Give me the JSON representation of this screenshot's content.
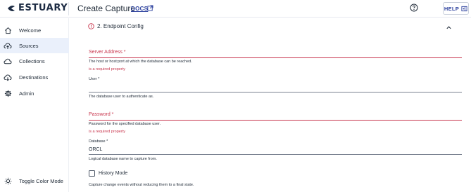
{
  "header": {
    "logo_text": "ESTUARY",
    "page_title": "Create Capture",
    "docs_label": "DOCS",
    "help_label": "HELP"
  },
  "sidebar": {
    "items": [
      {
        "label": "Welcome",
        "icon": "home-icon",
        "active": false
      },
      {
        "label": "Sources",
        "icon": "cloud-upload-icon",
        "active": true
      },
      {
        "label": "Collections",
        "icon": "cloud-icon",
        "active": false
      },
      {
        "label": "Destinations",
        "icon": "cloud-download-icon",
        "active": false
      },
      {
        "label": "Admin",
        "icon": "gear-icon",
        "active": false
      }
    ],
    "toggle_color_mode": "Toggle Color Mode"
  },
  "section": {
    "title": "2. Endpoint Config"
  },
  "fields": {
    "server_address": {
      "label": "Server Address *",
      "helper": "The host or host:port at which the database can be reached.",
      "error": "is a required property"
    },
    "user": {
      "label": "User *",
      "helper": "The database user to authenticate as."
    },
    "password": {
      "label": "Password *",
      "helper": "Password for the specified database user.",
      "error": "is a required property"
    },
    "database": {
      "label": "Database *",
      "value": "ORCL",
      "helper": "Logical database name to capture from."
    },
    "history_mode": {
      "label": "History Mode",
      "helper": "Capture change events without reducing them to a final state.",
      "checked": false
    }
  },
  "colors": {
    "brand": "#1c2b43",
    "link": "#2a3f9d",
    "error": "#c8354d",
    "active_nav": "#eaf0fb"
  }
}
